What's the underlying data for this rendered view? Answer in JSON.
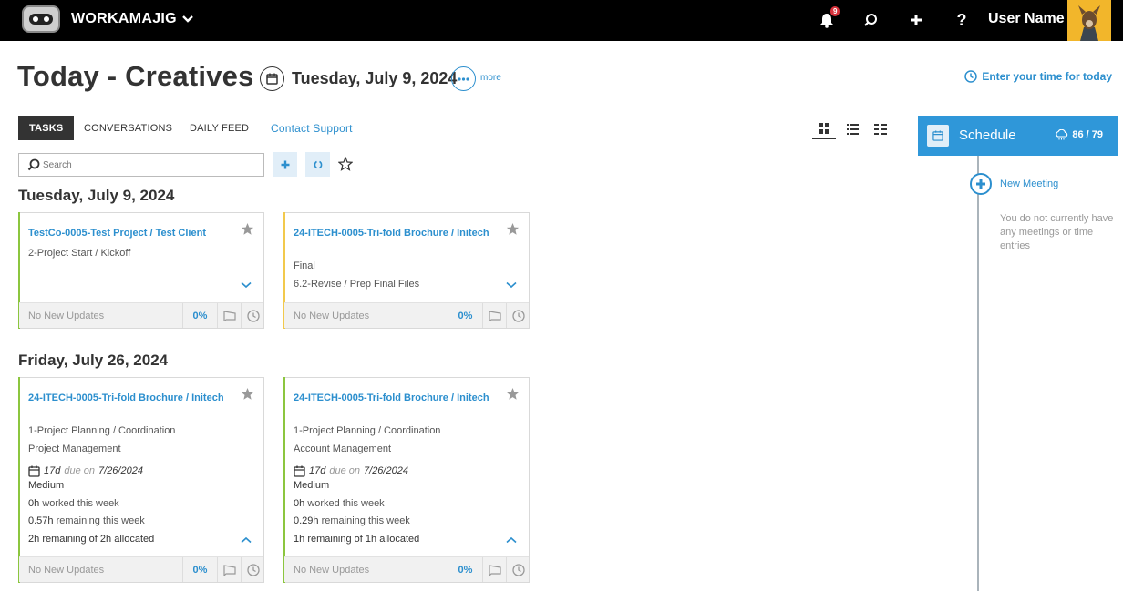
{
  "topbar": {
    "app_name": "WORKAMAJIG",
    "notification_count": "9",
    "help_label": "?",
    "user_name": "User Name"
  },
  "header": {
    "title": "Today - Creatives",
    "date": "Tuesday, July 9, 2024",
    "more_label": "more",
    "enter_time_label": "Enter your time for today"
  },
  "tabs": [
    {
      "label": "TASKS",
      "active": true
    },
    {
      "label": "CONVERSATIONS",
      "active": false
    },
    {
      "label": "DAILY FEED",
      "active": false
    },
    {
      "label": "Contact Support",
      "active": false
    }
  ],
  "search": {
    "placeholder": "Search"
  },
  "groups": [
    {
      "date": "Tuesday, July 9, 2024",
      "cards": [
        {
          "title": "TestCo-0005-Test Project / Test Client",
          "lines": [
            "2-Project Start / Kickoff"
          ],
          "updates": "No New Updates",
          "percent": "0%",
          "stripe": "#8cc63f"
        },
        {
          "title": "24-ITECH-0005-Tri-fold Brochure / Initech",
          "lines": [
            "Final",
            "6.2-Revise / Prep Final Files"
          ],
          "updates": "No New Updates",
          "percent": "0%",
          "stripe": "#f2c94c"
        }
      ]
    },
    {
      "date": "Friday, July 26, 2024",
      "cards": [
        {
          "title": "24-ITECH-0005-Tri-fold Brochure / Initech",
          "lines": [
            "1-Project Planning / Coordination",
            "Project Management"
          ],
          "duration": "17d",
          "due_word": "due on",
          "due_date": "7/26/2024",
          "priority": "Medium",
          "worked_hours": "0h",
          "worked_text": "worked this week",
          "remaining_hours": "0.57h",
          "remaining_text": "remaining this week",
          "alloc_remaining": "2h",
          "alloc_mid": "remaining of",
          "alloc_total": "2h",
          "alloc_end": "allocated",
          "updates": "No New Updates",
          "percent": "0%",
          "stripe": "#8cc63f"
        },
        {
          "title": "24-ITECH-0005-Tri-fold Brochure / Initech",
          "lines": [
            "1-Project Planning / Coordination",
            "Account Management"
          ],
          "duration": "17d",
          "due_word": "due on",
          "due_date": "7/26/2024",
          "priority": "Medium",
          "worked_hours": "0h",
          "worked_text": "worked this week",
          "remaining_hours": "0.29h",
          "remaining_text": "remaining this week",
          "alloc_remaining": "1h",
          "alloc_mid": "remaining of",
          "alloc_total": "1h",
          "alloc_end": "allocated",
          "updates": "No New Updates",
          "percent": "0%",
          "stripe": "#8cc63f"
        }
      ]
    }
  ],
  "schedule": {
    "label": "Schedule",
    "hours": "86 / 79",
    "new_meeting_label": "New Meeting",
    "empty_message": "You do not currently have any meetings or time entries"
  },
  "colors": {
    "accent": "#2c8fce",
    "schedule_bg": "#2f97d9",
    "topbar_bg": "#000000"
  },
  "icons": [
    "robot-logo-icon",
    "chevron-down-icon",
    "bell-icon",
    "search-icon",
    "plus-icon",
    "calendar-icon",
    "ellipsis-icon",
    "clock-icon",
    "grid-view-icon",
    "list-view-icon",
    "compact-list-icon",
    "star-icon",
    "refresh-icon",
    "chevron-up-icon",
    "message-icon",
    "cloud-icon"
  ]
}
